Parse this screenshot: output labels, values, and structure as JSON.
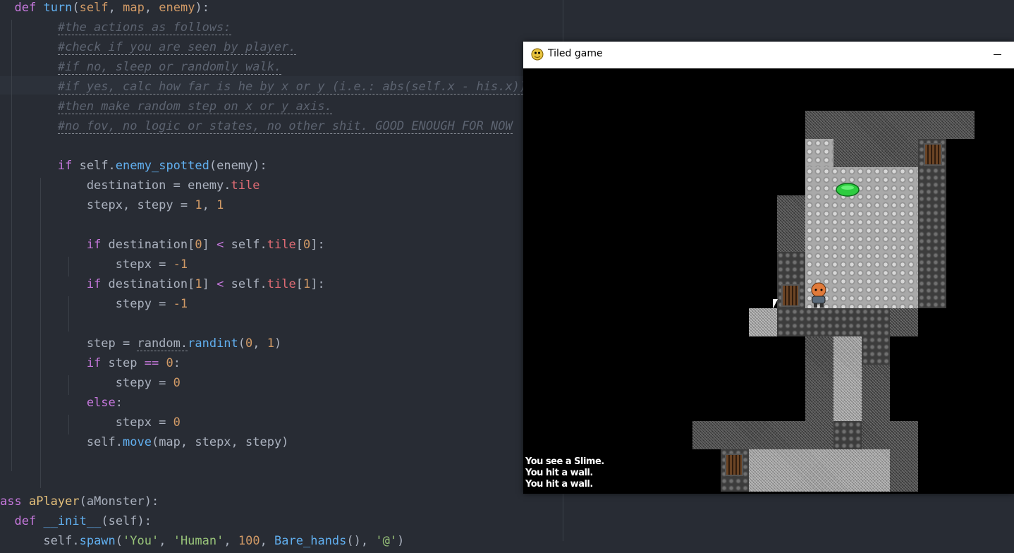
{
  "editor": {
    "lines": [
      [
        "  ",
        {
          "t": "def",
          "c": "kw"
        },
        " ",
        {
          "t": "turn",
          "c": "fn"
        },
        "(",
        {
          "t": "self",
          "c": "arg"
        },
        ", ",
        {
          "t": "map",
          "c": "arg"
        },
        ", ",
        {
          "t": "enemy",
          "c": "arg"
        },
        "):"
      ],
      [
        "        ",
        {
          "t": "#the actions as follows:",
          "c": "cm"
        }
      ],
      [
        "        ",
        {
          "t": "#check if you are seen by player.",
          "c": "cm"
        }
      ],
      [
        "        ",
        {
          "t": "#if no, sleep or randomly walk.",
          "c": "cm"
        }
      ],
      [
        "        ",
        {
          "t": "#if yes, calc how far is he by x or y (i.e.: abs(self.x - his.x)).",
          "c": "cm"
        }
      ],
      [
        "        ",
        {
          "t": "#then make random step on x or y axis.",
          "c": "cm"
        }
      ],
      [
        "        ",
        {
          "t": "#no fov, no logic or states, no other shit. GOOD ENOUGH FOR NOW",
          "c": "cm"
        }
      ],
      [
        ""
      ],
      [
        "        ",
        {
          "t": "if",
          "c": "kw"
        },
        " self.",
        {
          "t": "enemy_spotted",
          "c": "fn"
        },
        "(enemy):"
      ],
      [
        "            destination = enemy.",
        {
          "t": "tile",
          "c": "pr"
        }
      ],
      [
        "            stepx, stepy = ",
        {
          "t": "1",
          "c": "num"
        },
        ", ",
        {
          "t": "1",
          "c": "num"
        }
      ],
      [
        ""
      ],
      [
        "            ",
        {
          "t": "if",
          "c": "kw"
        },
        " destination[",
        {
          "t": "0",
          "c": "num"
        },
        "] ",
        {
          "t": "<",
          "c": "kw"
        },
        " self.",
        {
          "t": "tile",
          "c": "pr"
        },
        "[",
        {
          "t": "0",
          "c": "num"
        },
        "]:"
      ],
      [
        "                stepx = ",
        {
          "t": "-1",
          "c": "num"
        }
      ],
      [
        "            ",
        {
          "t": "if",
          "c": "kw"
        },
        " destination[",
        {
          "t": "1",
          "c": "num"
        },
        "] ",
        {
          "t": "<",
          "c": "kw"
        },
        " self.",
        {
          "t": "tile",
          "c": "pr"
        },
        "[",
        {
          "t": "1",
          "c": "num"
        },
        "]:"
      ],
      [
        "                stepy = ",
        {
          "t": "-1",
          "c": "num"
        }
      ],
      [
        ""
      ],
      [
        "            step = ",
        {
          "t": "random.",
          "c": "ul"
        },
        {
          "t": "randint",
          "c": "fn"
        },
        "(",
        {
          "t": "0",
          "c": "num"
        },
        ", ",
        {
          "t": "1",
          "c": "num"
        },
        ")"
      ],
      [
        "            ",
        {
          "t": "if",
          "c": "kw"
        },
        " step ",
        {
          "t": "==",
          "c": "kw"
        },
        " ",
        {
          "t": "0",
          "c": "num"
        },
        ":"
      ],
      [
        "                stepy = ",
        {
          "t": "0",
          "c": "num"
        }
      ],
      [
        "            ",
        {
          "t": "else",
          "c": "kw"
        },
        ":"
      ],
      [
        "                stepx = ",
        {
          "t": "0",
          "c": "num"
        }
      ],
      [
        "            self.",
        {
          "t": "move",
          "c": "fn"
        },
        "(map, stepx, stepy)"
      ],
      [
        ""
      ],
      [
        ""
      ],
      [
        {
          "t": "ass",
          "c": "kw"
        },
        " ",
        {
          "t": "aPlayer",
          "c": "str2"
        },
        "(aMonster):"
      ],
      [
        "  ",
        {
          "t": "def",
          "c": "kw"
        },
        " ",
        {
          "t": "__init__",
          "c": "fn"
        },
        "(self):"
      ],
      [
        "      self.",
        {
          "t": "spawn",
          "c": "fn"
        },
        "(",
        {
          "t": "'You'",
          "c": "str"
        },
        ", ",
        {
          "t": "'Human'",
          "c": "str"
        },
        ", ",
        {
          "t": "100",
          "c": "num"
        },
        ", ",
        {
          "t": "Bare_hands",
          "c": "fn"
        },
        "(), ",
        {
          "t": "'@'",
          "c": "str"
        },
        ")"
      ]
    ]
  },
  "game_window": {
    "title": "Tiled game",
    "icon": "python-snake-icon",
    "minimize_icon": "minimize-icon",
    "log": [
      "You see a Slime.",
      "You hit a wall.",
      "You hit a wall."
    ],
    "colors": {
      "slime": "#2ecc40",
      "player_skin": "#e07a3a",
      "door": "#6b4425"
    }
  }
}
